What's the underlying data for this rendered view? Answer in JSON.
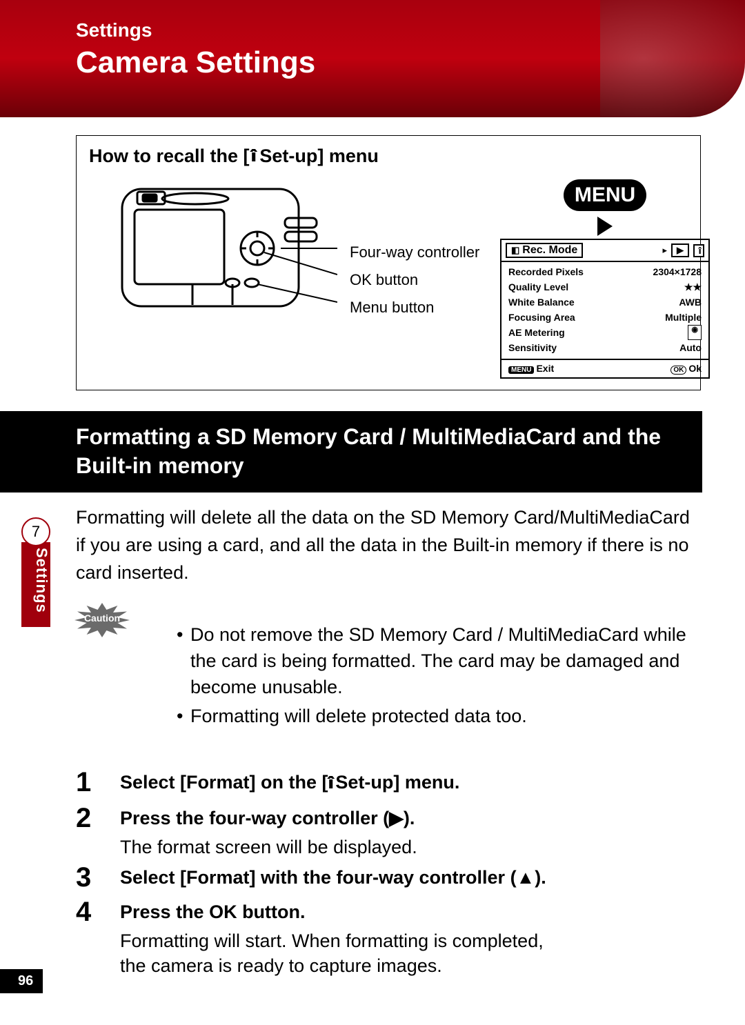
{
  "banner": {
    "section": "Settings",
    "title": "Camera Settings"
  },
  "diagram": {
    "how_title_pre": "How to recall the [",
    "how_title_icon": "B",
    "how_title_post": " Set-up] menu",
    "callouts": {
      "four_way": "Four-way controller",
      "ok_button": "OK button",
      "menu_button": "Menu button"
    },
    "menu_label": "MENU",
    "menu_screen": {
      "tab_label": "Rec. Mode",
      "rows": [
        {
          "label": "Recorded Pixels",
          "value": "2304×1728"
        },
        {
          "label": "Quality Level",
          "value": "★★"
        },
        {
          "label": "White Balance",
          "value": "AWB"
        },
        {
          "label": "Focusing Area",
          "value": "Multiple"
        },
        {
          "label": "AE Metering",
          "value": "[◎]"
        },
        {
          "label": "Sensitivity",
          "value": "Auto"
        }
      ],
      "footer_left_badge": "MENU",
      "footer_left": "Exit",
      "footer_right_badge": "OK",
      "footer_right": "Ok"
    }
  },
  "heading": "Formatting a SD Memory Card / MultiMediaCard and the Built-in memory",
  "intro": "Formatting will delete all the data on the SD Memory Card/MultiMediaCard if you are using a card, and all the data in the Built-in memory if there is no card inserted.",
  "caution": {
    "label": "Caution",
    "items": [
      "Do not remove the SD Memory Card / MultiMediaCard while the card is being formatted. The card may be damaged and become unusable.",
      "Formatting will delete protected data too."
    ]
  },
  "steps": [
    {
      "n": "1",
      "title_pre": "Select [Format] on the [",
      "title_icon": "B",
      "title_post": " Set-up] menu."
    },
    {
      "n": "2",
      "title_full": "Press the four-way controller (▶).",
      "desc": "The format screen will be displayed."
    },
    {
      "n": "3",
      "title_full": "Select [Format] with the four-way controller (▲)."
    },
    {
      "n": "4",
      "title_full": "Press the OK button.",
      "desc": "Formatting will start. When formatting is completed,\nthe camera is ready to capture images."
    }
  ],
  "side": {
    "number": "7",
    "label": "Settings"
  },
  "page_number": "96"
}
